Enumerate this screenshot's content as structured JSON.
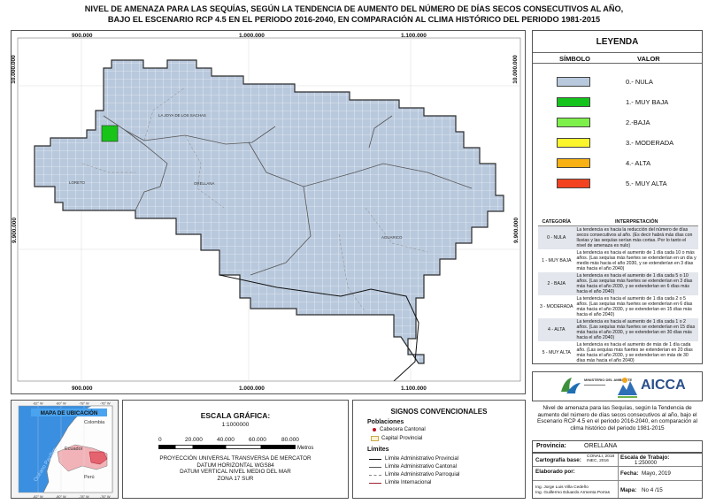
{
  "title": {
    "line1": "NIVEL DE AMENAZA PARA LAS SEQUÍAS, SEGÚN LA TENDENCIA DE AUMENTO DEL NÚMERO DE DÍAS SECOS CONSECUTIVOS AL AÑO,",
    "line2": "BAJO EL ESCENARIO RCP 4.5 EN EL PERIODO 2016-2040, EN COMPARACIÓN AL CLIMA HISTÓRICO DEL PERIODO 1981-2015"
  },
  "map": {
    "x_coords": [
      "900.000",
      "1.000.000",
      "1.100.000"
    ],
    "y_coords": [
      "10.000.000",
      "9.900.000"
    ],
    "place_labels": [
      "LA JOYA DE LOS SACHAS",
      "LORETO",
      "ORELLANA",
      "AGUARICO"
    ],
    "grid_fill": "#b9c9dd",
    "highlight_fill": "#18c418"
  },
  "legend": {
    "title": "LEYENDA",
    "col_symbol": "SÍMBOLO",
    "col_value": "VALOR",
    "items": [
      {
        "label": "0.- NULA",
        "color": "#b9c9dd"
      },
      {
        "label": "1.- MUY BAJA",
        "color": "#14c41c"
      },
      {
        "label": "2.-BAJA",
        "color": "#7ef04a"
      },
      {
        "label": "3.- MODERADA",
        "color": "#fbf52b"
      },
      {
        "label": "4.- ALTA",
        "color": "#f7b112"
      },
      {
        "label": "5.- MUY ALTA",
        "color": "#f3421f"
      }
    ],
    "interp_head_cat": "CATEGORÍA",
    "interp_head_text": "INTERPRETACIÓN",
    "interpretations": [
      {
        "cat": "0 - NULA",
        "text": "La tendencia es hacia la reducción del número de días secos consecutivos al año. (Es decir habrá más días con lluvias y las sequías serían más cortas. Por lo tanto el nivel de amenaza es nulo)"
      },
      {
        "cat": "1 - MUY BAJA",
        "text": "La tendencia es hacia el aumento de 1 día cada 10 o más años. (Las sequías más fuertes se extenderían en un día y medio más hacia el año 2030, y se extenderían en 3 días más hacia el año 2040)"
      },
      {
        "cat": "2 - BAJA",
        "text": "La tendencia es hacia el aumento de 1 día cada 5 o 10 años. (Las sequías más fuertes se extenderían en 3 días más hacia el año 2030, y se extenderían en 6 días más hacia el año 2040)"
      },
      {
        "cat": "3 - MODERADA",
        "text": "La tendencia es hacia el aumento de 1 día cada 2 o 5 años. (Las sequías más fuertes se extenderían en 6 días más hacia el año 2030, y se extenderían en 15 días más hacia el año 2040)"
      },
      {
        "cat": "4 - ALTA",
        "text": "La tendencia es hacia el aumento de 1 día cada 1 o 2 años. (Las sequías más fuertes se extenderían en 15 días más hacia el año 2030, y se extenderían en 30 días más hacia el año 2040)"
      },
      {
        "cat": "5 - MUY ALTA",
        "text": "La tendencia es hacia el aumento de más de 1 día cada año. (Las sequías más fuertes se extenderían en 20 días más hacia el año 2030, y se extenderían en más de 30 días más hacia el año 2040)"
      }
    ]
  },
  "logos": {
    "ministry": "MINISTERIO DEL AMBIENTE",
    "project": "AICCA"
  },
  "description": "Nivel de amenaza para las Sequías, según la Tendencia de aumento del número de días secos consecutivos al año, bajo el Escenario RCP 4.5 en el periodo 2016-2040, en comparación al clima histórico del periodo 1981-2015",
  "province": {
    "label": "Provincia:",
    "value": "ORELLANA"
  },
  "info": {
    "base_label": "Cartografía base:",
    "base_value": "CONALI, 2018 INEC, 2016",
    "scale_label": "Escala de Trabajo:",
    "scale_value": "1:250000",
    "made_label": "Elaborado por:",
    "author1": "Ing. Jorge Luis Villa Cedeño",
    "author2": "Ing. Guillermo Eduardo Armenta Porras",
    "date_label": "Fecha:",
    "date_value": "Mayo, 2019",
    "map_label": "Mapa:",
    "map_value": "No 4 /15"
  },
  "location": {
    "title": "MAPA DE UBICACIÓN",
    "ocean": "Océano Pacífico",
    "countries": [
      "Colombia",
      "Ecuador",
      "Perú"
    ],
    "lon_ticks": [
      "-82° W",
      "-80° W",
      "-78° W",
      "-76° W"
    ]
  },
  "scale": {
    "title": "ESCALA GRÁFICA:",
    "ratio": "1:1000000",
    "ticks": [
      "0",
      "20.000",
      "40.000",
      "60.000",
      "80.000"
    ],
    "unit": "Metros",
    "projection": [
      "PROYECCIÓN UNIVERSAL TRANSVERSA DE MERCATOR",
      "DATUM HORIZONTAL WGS84",
      "DATUM VERTICAL NIVEL MEDIO DEL MAR",
      "ZONA 17 SUR"
    ]
  },
  "signs": {
    "title": "SIGNOS CONVENCIONALES",
    "poblaciones": "Poblaciones",
    "cabecera": "Cabecera Cantonal",
    "capital": "Capital Provincial",
    "limites": "Límites",
    "lim_prov": "Límite Administrativo Provincial",
    "lim_cant": "Límite Administrativo Cantonal",
    "lim_parr": "Límite Administrativo Parroquial",
    "lim_int": "Límite Internacional"
  }
}
